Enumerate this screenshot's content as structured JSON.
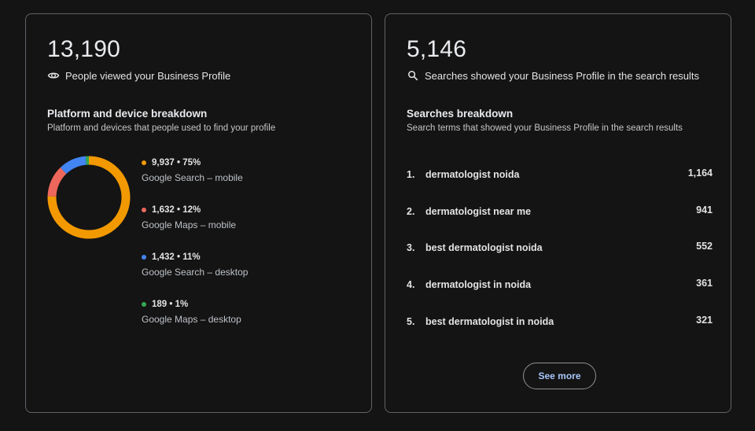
{
  "views_card": {
    "total": "13,190",
    "caption": "People viewed your Business Profile",
    "icon": "eye-icon",
    "section_title": "Platform and device breakdown",
    "section_subtitle": "Platform and devices that people used to find your profile",
    "breakdown": [
      {
        "stat": "9,937 • 75%",
        "name": "Google Search – mobile",
        "value": 9937,
        "percent": 75,
        "color": "#f29900"
      },
      {
        "stat": "1,632 • 12%",
        "name": "Google Maps – mobile",
        "value": 1632,
        "percent": 12,
        "color": "#ee675c"
      },
      {
        "stat": "1,432 • 11%",
        "name": "Google Search – desktop",
        "value": 1432,
        "percent": 11,
        "color": "#4285f4"
      },
      {
        "stat": "189 • 1%",
        "name": "Google Maps – desktop",
        "value": 189,
        "percent": 1,
        "color": "#34a853"
      }
    ]
  },
  "searches_card": {
    "total": "5,146",
    "caption": "Searches showed your Business Profile in the search results",
    "icon": "search-icon",
    "section_title": "Searches breakdown",
    "section_subtitle": "Search terms that showed your Business Profile in the search results",
    "terms": [
      {
        "index": "1.",
        "term": "dermatologist noida",
        "count": "1,164"
      },
      {
        "index": "2.",
        "term": "dermatologist near me",
        "count": "941"
      },
      {
        "index": "3.",
        "term": "best dermatologist noida",
        "count": "552"
      },
      {
        "index": "4.",
        "term": "dermatologist in noida",
        "count": "361"
      },
      {
        "index": "5.",
        "term": "best dermatologist in noida",
        "count": "321"
      }
    ],
    "see_more_label": "See more",
    "accent_color": "#a8c7fa"
  }
}
